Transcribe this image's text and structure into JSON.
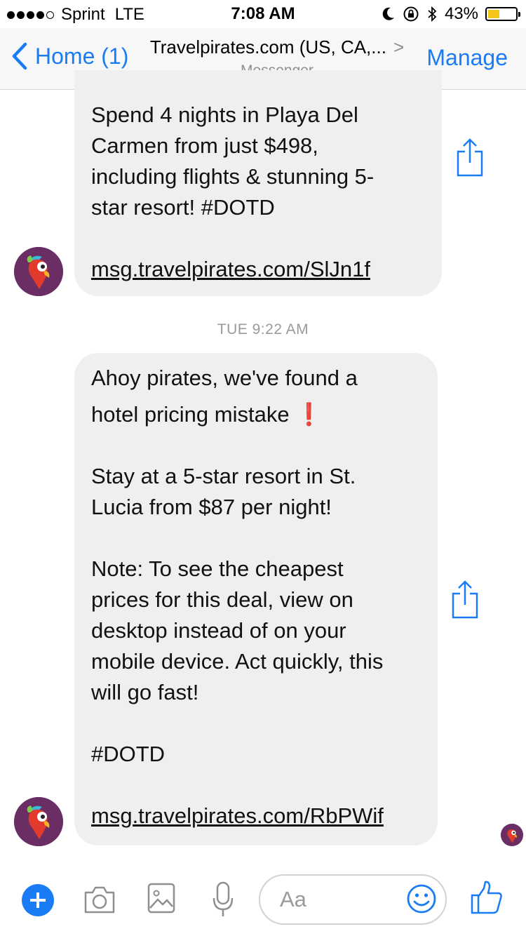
{
  "status_bar": {
    "carrier": "Sprint",
    "network": "LTE",
    "time": "7:08 AM",
    "battery": "43%",
    "battery_level": 0.43
  },
  "nav": {
    "back_label": "Home (1)",
    "title": "Travelpirates.com (US, CA,...",
    "subtitle": "Messenger",
    "manage_label": "Manage"
  },
  "messages": [
    {
      "lines": [
        "Spend 4 nights in Playa Del",
        "Carmen from just $498,",
        "including flights & stunning 5-",
        "star resort!  #DOTD"
      ],
      "link": "msg.travelpirates.com/SlJn1f"
    },
    {
      "timestamp": "TUE 9:22 AM",
      "para1_line1": "Ahoy pirates, we've found a",
      "para1_line2": "hotel pricing mistake",
      "exclamation": "❗",
      "para2": [
        "Stay at a 5-star resort in St.",
        "Lucia from $87 per night!"
      ],
      "para3": [
        "Note: To see the cheapest",
        "prices for this deal, view on",
        "desktop instead of on your",
        "mobile device. Act quickly, this",
        "will go fast!"
      ],
      "hashtag": "#DOTD",
      "link": "msg.travelpirates.com/RbPWif"
    }
  ],
  "composer": {
    "placeholder": "Aa"
  },
  "colors": {
    "accent": "#1a7cf5",
    "bubble": "#efefef",
    "avatar_bg": "#6a2d64"
  },
  "icons": [
    "chevron-left-icon",
    "share-icon",
    "plus-icon",
    "camera-icon",
    "image-icon",
    "microphone-icon",
    "emoji-icon",
    "thumbs-up-icon",
    "parrot-avatar"
  ]
}
